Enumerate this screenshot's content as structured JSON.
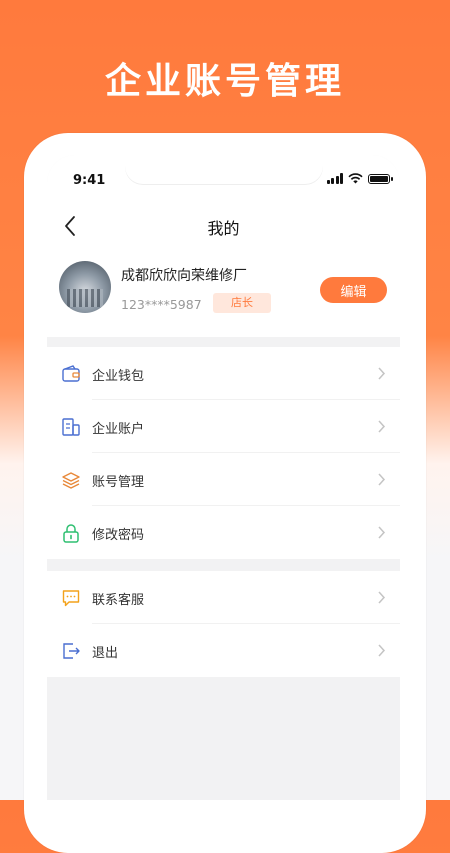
{
  "banner": {
    "title": "企业账号管理"
  },
  "status_bar": {
    "time": "9:41"
  },
  "nav": {
    "title": "我的"
  },
  "profile": {
    "company_name": "成都欣欣向荣维修厂",
    "phone": "123****5987",
    "role": "店长",
    "edit_label": "编辑"
  },
  "menu_group_1": [
    {
      "label": "企业钱包",
      "icon": "wallet-icon"
    },
    {
      "label": "企业账户",
      "icon": "account-icon"
    },
    {
      "label": "账号管理",
      "icon": "layers-icon"
    },
    {
      "label": "修改密码",
      "icon": "lock-icon"
    }
  ],
  "menu_group_2": [
    {
      "label": "联系客服",
      "icon": "chat-icon"
    },
    {
      "label": "退出",
      "icon": "logout-icon"
    }
  ],
  "colors": {
    "accent": "#ff7a3d",
    "badge_bg": "#ffe7dc",
    "icon_blue": "#4a6fd1",
    "icon_orange": "#e8893a",
    "icon_green": "#2fbf71",
    "icon_yellow": "#f3a21b"
  }
}
